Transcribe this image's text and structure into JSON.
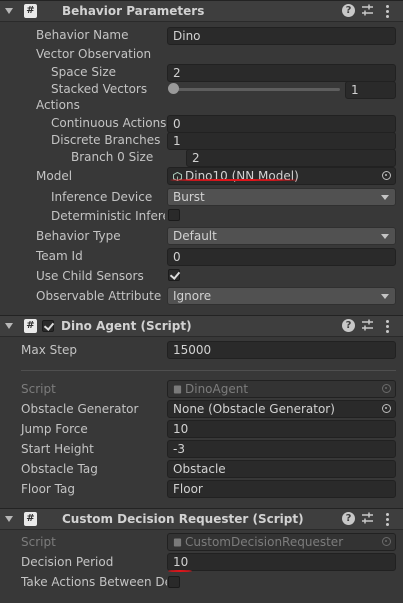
{
  "behavior_parameters": {
    "title": "Behavior Parameters",
    "fields": {
      "behavior_name": {
        "label": "Behavior Name",
        "value": "Dino"
      },
      "vector_observation": {
        "label": "Vector Observation"
      },
      "space_size": {
        "label": "Space Size",
        "value": "2"
      },
      "stacked_vectors": {
        "label": "Stacked Vectors",
        "value": "1"
      },
      "actions": {
        "label": "Actions"
      },
      "continuous_actions": {
        "label": "Continuous Actions",
        "value": "0"
      },
      "discrete_branches": {
        "label": "Discrete Branches",
        "value": "1"
      },
      "branch_0_size": {
        "label": "Branch 0 Size",
        "value": "2"
      },
      "model": {
        "label": "Model",
        "value": "Dino10 (NN Model)"
      },
      "inference_device": {
        "label": "Inference Device",
        "value": "Burst"
      },
      "deterministic_inference": {
        "label": "Deterministic Inferen"
      },
      "behavior_type": {
        "label": "Behavior Type",
        "value": "Default"
      },
      "team_id": {
        "label": "Team Id",
        "value": "0"
      },
      "use_child_sensors": {
        "label": "Use Child Sensors",
        "checked": true
      },
      "observable_attribute": {
        "label": "Observable Attribute Ha",
        "value": "Ignore"
      }
    }
  },
  "dino_agent": {
    "title": "Dino Agent (Script)",
    "enabled": true,
    "fields": {
      "max_step": {
        "label": "Max Step",
        "value": "15000"
      },
      "script": {
        "label": "Script",
        "value": "DinoAgent"
      },
      "obstacle_generator": {
        "label": "Obstacle Generator",
        "value": "None (Obstacle Generator)"
      },
      "jump_force": {
        "label": "Jump Force",
        "value": "10"
      },
      "start_height": {
        "label": "Start Height",
        "value": "-3"
      },
      "obstacle_tag": {
        "label": "Obstacle Tag",
        "value": "Obstacle"
      },
      "floor_tag": {
        "label": "Floor Tag",
        "value": "Floor"
      }
    }
  },
  "decision_requester": {
    "title": "Custom Decision Requester (Script)",
    "fields": {
      "script": {
        "label": "Script",
        "value": "CustomDecisionRequester"
      },
      "decision_period": {
        "label": "Decision Period",
        "value": "10"
      },
      "take_actions_between": {
        "label": "Take Actions Between De"
      }
    }
  },
  "stacked_vectors_slider_fraction": 0,
  "icons": {
    "script": "#",
    "help": "?",
    "fold": "chevron-down-icon",
    "presets": "presets-icon",
    "menu": "kebab-menu-icon",
    "picker": "object-picker-icon"
  },
  "colors": {
    "background": "#383838",
    "header": "#3e3e3e",
    "field": "#2a2a2a",
    "annotation": "#e0151b"
  }
}
